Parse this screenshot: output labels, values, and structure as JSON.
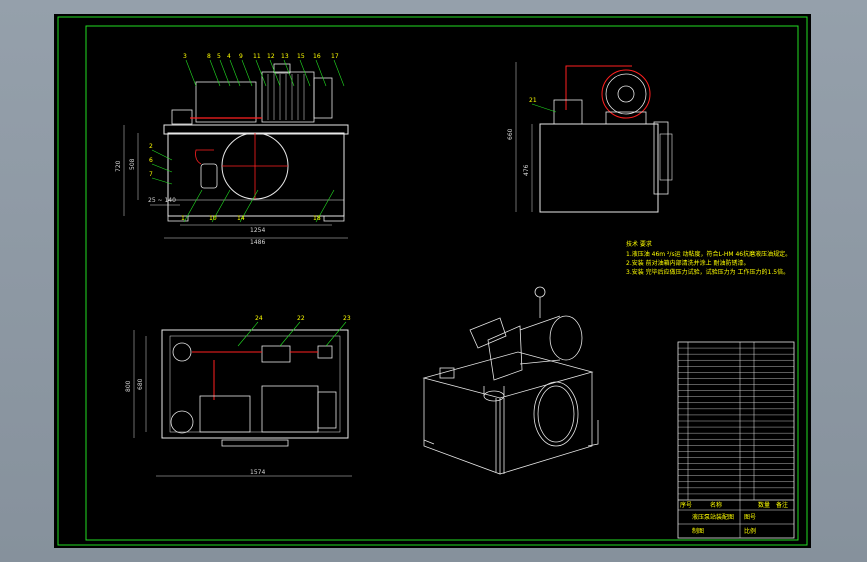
{
  "drawing": {
    "background": "#000000",
    "frame_color": "#22dd22",
    "outline_color": "#e8e8e8",
    "part_color": "#ffffff",
    "pipe_color": "#ff2020",
    "leader_color": "#22dd22",
    "text_color": "#ffff00"
  },
  "views": {
    "front": {
      "balloons": [
        "3",
        "8",
        "5",
        "4",
        "9",
        "11",
        "12",
        "13",
        "15",
        "16",
        "17"
      ],
      "left_balloons": [
        "2",
        "6",
        "7"
      ],
      "bottom_balloons": [
        "1",
        "10",
        "14",
        "18"
      ],
      "dims": {
        "height_outer": "720",
        "height_inner": "508",
        "width_inner": "1254",
        "width_outer": "1486",
        "offset": "25 ~ 140"
      }
    },
    "side": {
      "balloons": [
        "21"
      ],
      "dims": {
        "height_outer": "660",
        "height_inner": "476"
      }
    },
    "top": {
      "balloons": [
        "24",
        "22",
        "23"
      ],
      "dims": {
        "width": "1574",
        "height_outer": "800",
        "height_inner": "680"
      }
    },
    "iso": {
      "label": ""
    }
  },
  "notes": {
    "title": "技术 要求",
    "lines": [
      "1.液压油 46m ²/s运 动粘度，符合L-HM 46抗磨液压油规定。",
      "2.安装 前对油箱内部清洗并涂上 耐油防锈漆。",
      "3.安装 完毕后应做压力试验，试验压力为 工作压力的1.5倍。"
    ]
  },
  "title_block": {
    "parts_rows": 26,
    "header": [
      "序号",
      "名称",
      "数量",
      "备注"
    ],
    "title_text": "液压泵站装配图",
    "scale_label": "比例",
    "drawn_label": "制图",
    "sheet_label": "图号"
  }
}
